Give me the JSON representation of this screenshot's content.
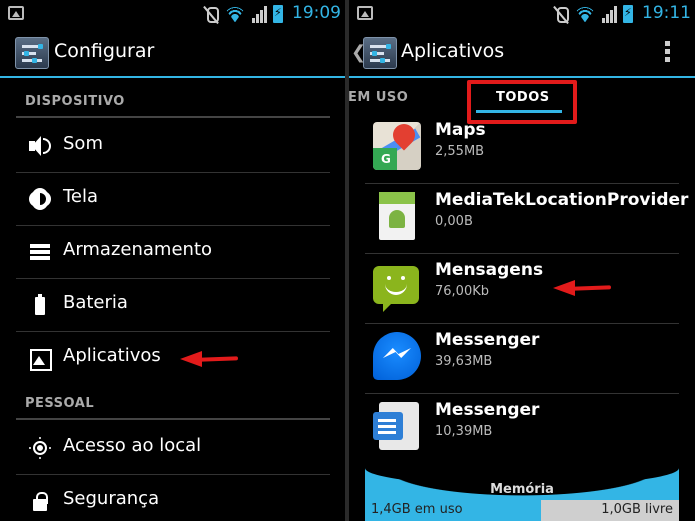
{
  "left": {
    "status": {
      "time": "19:09"
    },
    "title": "Configurar",
    "sections": [
      {
        "header": "DISPOSITIVO",
        "items": [
          "Som",
          "Tela",
          "Armazenamento",
          "Bateria",
          "Aplicativos"
        ]
      },
      {
        "header": "PESSOAL",
        "items": [
          "Acesso ao local",
          "Segurança"
        ]
      }
    ]
  },
  "right": {
    "status": {
      "time": "19:11"
    },
    "title": "Aplicativos",
    "tabs": [
      "EM USO",
      "TODOS"
    ],
    "apps": [
      {
        "name": "Maps",
        "size": "2,55MB",
        "icon": "google-maps-icon"
      },
      {
        "name": "MediaTekLocationProvider",
        "size": "0,00B",
        "icon": "android-app-icon"
      },
      {
        "name": "Mensagens",
        "size": "76,00Kb",
        "icon": "messaging-icon"
      },
      {
        "name": "Messenger",
        "size": "39,63MB",
        "icon": "facebook-messenger-icon"
      },
      {
        "name": "Messenger",
        "size": "10,39MB",
        "icon": "google-messenger-icon"
      }
    ],
    "memory": {
      "title": "Memória",
      "used": "1,4GB em uso",
      "free": "1,0GB livre",
      "used_fraction": 0.56
    }
  },
  "colors": {
    "accent": "#33b5e5",
    "annotation": "#e21b1b"
  }
}
